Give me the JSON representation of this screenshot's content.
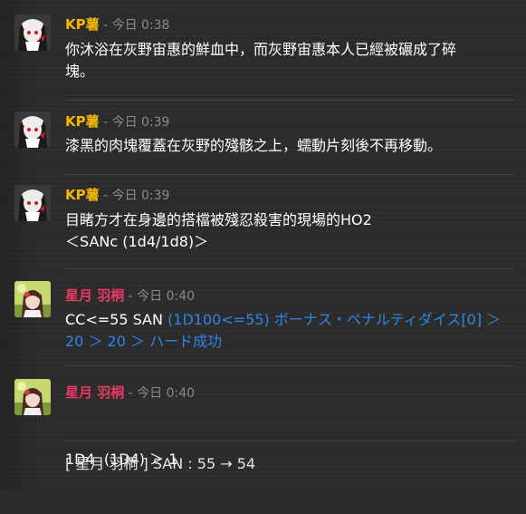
{
  "messages": [
    {
      "name": "KP薯",
      "sep": " - ",
      "time": "今日 0:38",
      "line1": "你沐浴在灰野宙惠的鮮血中，而灰野宙惠本人已經被碾成了碎",
      "line2": "塊。"
    },
    {
      "name": "KP薯",
      "sep": " - ",
      "time": "今日 0:39",
      "line1": "漆黑的肉塊覆蓋在灰野的殘骸之上，蠕動片刻後不再移動。"
    },
    {
      "name": "KP薯",
      "sep": " - ",
      "time": "今日 0:39",
      "line1": "目睹方才在身邊的搭檔被殘忍殺害的現場的HO2",
      "line2": "＜SANc (1d4/1d8)＞"
    },
    {
      "name": "星月 羽桐",
      "sep": " - ",
      "time": "今日 0:40",
      "cmd": "CC<=55 SAN ",
      "result1": "(1D100<=55) ボーナス・ペナルティダイス[0] ＞",
      "result2": "20 ＞ 20 ＞ ハード成功"
    },
    {
      "name": "星月 羽桐",
      "sep": " - ",
      "time": "今日 0:40",
      "line1": "1D4  (1D4) ＞ 1"
    }
  ],
  "system": "[ 星月 羽桐 ] SAN : 55 → 54",
  "colors": {
    "kp_name": "#f5b800",
    "hoshi_name": "#e83a63",
    "dice_result": "#2f86e8",
    "timestamp": "#8a8a8a",
    "background": "#2c2c2c"
  }
}
